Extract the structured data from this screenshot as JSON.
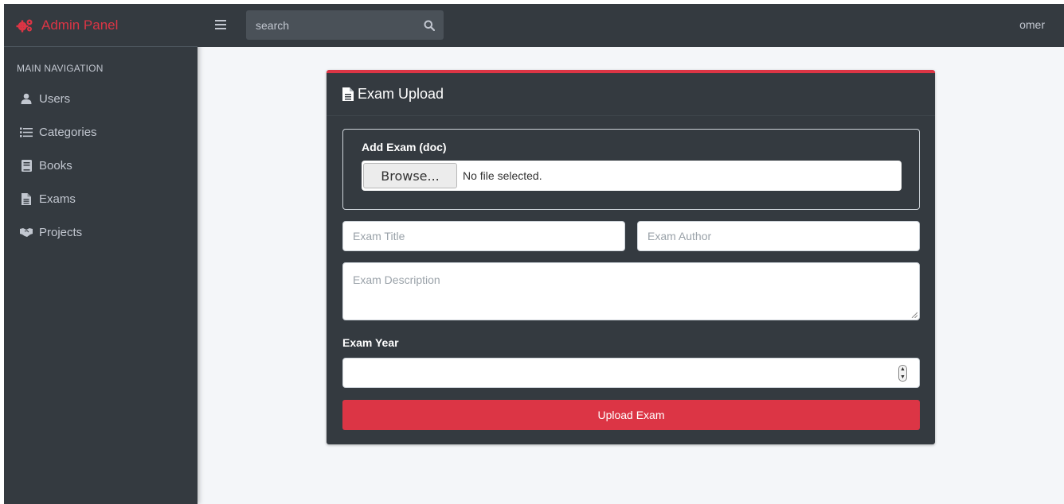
{
  "brand": {
    "name": "Admin Panel",
    "icon": "cogs-icon"
  },
  "topbar": {
    "search_placeholder": "search",
    "user": "omer"
  },
  "sidebar": {
    "header": "MAIN NAVIGATION",
    "items": [
      {
        "label": "Users",
        "icon": "user-icon"
      },
      {
        "label": "Categories",
        "icon": "list-icon"
      },
      {
        "label": "Books",
        "icon": "book-icon"
      },
      {
        "label": "Exams",
        "icon": "file-icon"
      },
      {
        "label": "Projects",
        "icon": "handshake-icon"
      }
    ]
  },
  "form": {
    "title": "Exam Upload",
    "file_label": "Add Exam (doc)",
    "browse_label": "Browse...",
    "file_status": "No file selected.",
    "title_placeholder": "Exam Title",
    "author_placeholder": "Exam Author",
    "description_placeholder": "Exam Description",
    "year_label": "Exam Year",
    "year_value": "",
    "submit_label": "Upload Exam"
  },
  "colors": {
    "accent": "#dc3545",
    "sidebar": "#343a40",
    "page_bg": "#f4f6f9"
  }
}
